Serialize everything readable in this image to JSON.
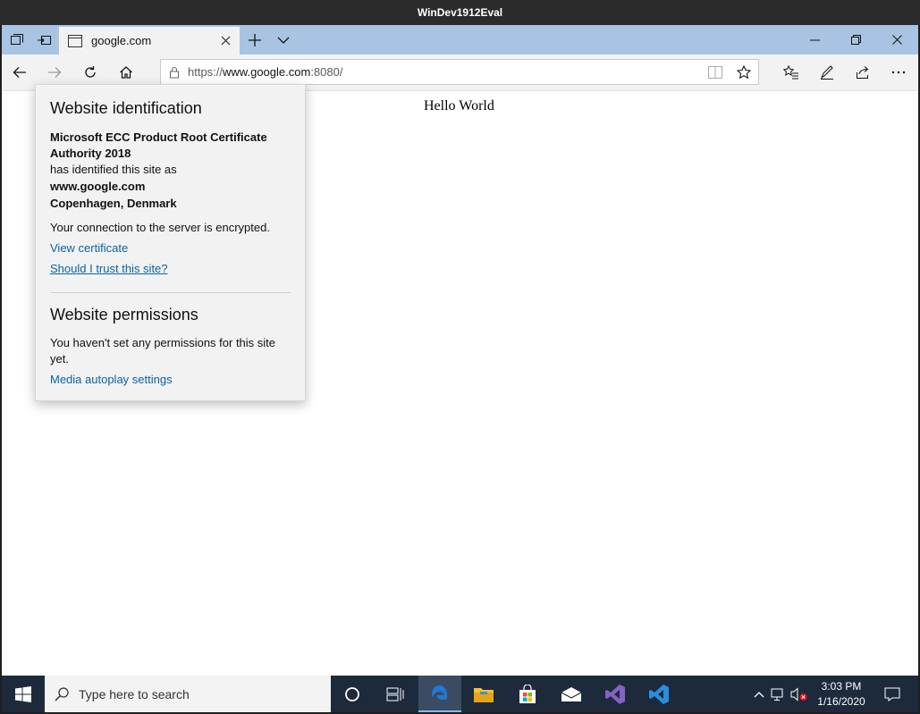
{
  "window": {
    "title": "WinDev1912Eval"
  },
  "tab": {
    "title": "google.com"
  },
  "address": {
    "url_prefix": "https://",
    "url_host": "www.google.com",
    "url_suffix": ":8080/"
  },
  "page": {
    "body_text": "Hello World"
  },
  "flyout": {
    "identification_heading": "Website identification",
    "issuer": "Microsoft ECC Product Root Certificate Authority 2018",
    "identified_text": "has identified this site as",
    "site": "www.google.com",
    "location": "Copenhagen, Denmark",
    "encryption_text": "Your connection to the server is encrypted.",
    "view_certificate": "View certificate",
    "trust_link": "Should I trust this site?",
    "permissions_heading": "Website permissions",
    "permissions_text": "You haven't set any permissions for this site yet.",
    "autoplay_link": "Media autoplay settings"
  },
  "taskbar": {
    "search_placeholder": "Type here to search",
    "time": "3:03 PM",
    "date": "1/16/2020"
  },
  "colors": {
    "link": "#0b61a4",
    "tabbar": "#a8c4e2",
    "taskbar": "#1c2a3c",
    "edge": "#1e7ad6"
  }
}
